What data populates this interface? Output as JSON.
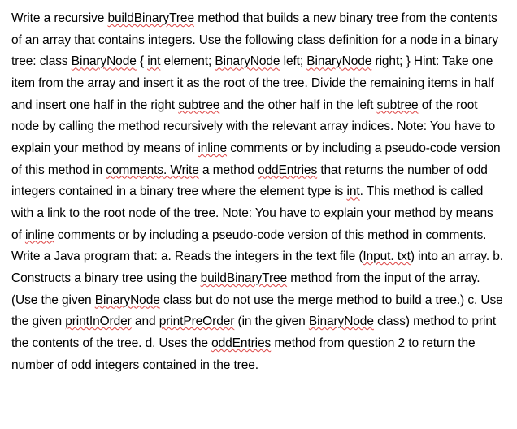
{
  "document": {
    "segments": [
      {
        "text": "Write a recursive ",
        "spell": false
      },
      {
        "text": "buildBinaryTree",
        "spell": true
      },
      {
        "text": " method that builds a new binary tree from the contents of an array that contains integers. Use the following class definition for a node in a binary tree: class ",
        "spell": false
      },
      {
        "text": "BinaryNode",
        "spell": true
      },
      {
        "text": " { ",
        "spell": false
      },
      {
        "text": "int",
        "spell": true
      },
      {
        "text": " element; ",
        "spell": false
      },
      {
        "text": "BinaryNode",
        "spell": true
      },
      {
        "text": " left; ",
        "spell": false
      },
      {
        "text": "BinaryNode",
        "spell": true
      },
      {
        "text": " right; } Hint: Take one item from the array and insert it as the root of the tree. Divide the remaining items in half and insert one half in the right ",
        "spell": false
      },
      {
        "text": "subtree",
        "spell": true
      },
      {
        "text": " and the other half in the left ",
        "spell": false
      },
      {
        "text": "subtree",
        "spell": true
      },
      {
        "text": " of the root node by calling the method recursively with the relevant array indices. Note: You have to explain your method by means of ",
        "spell": false
      },
      {
        "text": "inline",
        "spell": true
      },
      {
        "text": " comments or by including a pseudo-code version of this method in ",
        "spell": false
      },
      {
        "text": "comments. Write",
        "spell": true
      },
      {
        "text": " a method ",
        "spell": false
      },
      {
        "text": "oddEntries",
        "spell": true
      },
      {
        "text": " that returns the number of odd integers contained in a binary tree where the element type is ",
        "spell": false
      },
      {
        "text": "int",
        "spell": true
      },
      {
        "text": ". This method is called with a link to the root node of the tree. Note: You have to explain your method by means of ",
        "spell": false
      },
      {
        "text": "inline",
        "spell": true
      },
      {
        "text": " comments or by including a pseudo-code version of this method in comments. Write a Java program that: a. Reads the integers in the text file (",
        "spell": false
      },
      {
        "text": "Input. txt",
        "spell": true
      },
      {
        "text": ") into an array. b.  Constructs a binary tree using the ",
        "spell": false
      },
      {
        "text": "buildBinaryTree",
        "spell": true
      },
      {
        "text": " method from the input of the array.  (Use the given ",
        "spell": false
      },
      {
        "text": "BinaryNode",
        "spell": true
      },
      {
        "text": " class but do not use the merge method to build a  tree.) c. Use the given ",
        "spell": false
      },
      {
        "text": "printInOrder",
        "spell": true
      },
      {
        "text": " and ",
        "spell": false
      },
      {
        "text": "printPreOrder",
        "spell": true
      },
      {
        "text": " (in the given ",
        "spell": false
      },
      {
        "text": "BinaryNode",
        "spell": true
      },
      {
        "text": " class) method to print the contents of the tree. d. Uses the ",
        "spell": false
      },
      {
        "text": "oddEntries",
        "spell": true
      },
      {
        "text": " method from question 2 to return the number of odd integers contained in the tree.",
        "spell": false
      }
    ]
  }
}
